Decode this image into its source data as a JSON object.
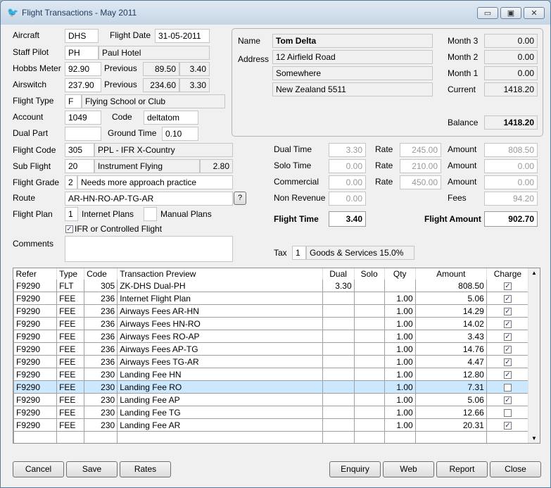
{
  "window": {
    "title": "Flight Transactions - May 2011",
    "min": "▭",
    "max": "▣",
    "close": "✕"
  },
  "form": {
    "aircraft_label": "Aircraft",
    "aircraft": "DHS",
    "flight_date_label": "Flight Date",
    "flight_date": "31-05-2011",
    "staff_pilot_label": "Staff Pilot",
    "staff_pilot_code": "PH",
    "staff_pilot_name": "Paul Hotel",
    "hobbs_label": "Hobbs Meter",
    "hobbs": "92.90",
    "previous_label": "Previous",
    "hobbs_prev": "89.50",
    "hobbs_diff": "3.40",
    "airswitch_label": "Airswitch",
    "airswitch": "237.90",
    "airswitch_prev": "234.60",
    "airswitch_diff": "3.30",
    "flight_type_label": "Flight Type",
    "flight_type_code": "F",
    "flight_type_name": "Flying School or Club",
    "account_label": "Account",
    "account": "1049",
    "code_label": "Code",
    "code": "deltatom",
    "dual_part_label": "Dual Part",
    "dual_part": "",
    "ground_time_label": "Ground Time",
    "ground_time": "0.10",
    "flight_code_label": "Flight Code",
    "flight_code": "305",
    "flight_code_name": "PPL - IFR X-Country",
    "sub_flight_label": "Sub Flight",
    "sub_flight": "20",
    "sub_flight_name": "Instrument Flying",
    "sub_flight_value": "2.80",
    "flight_grade_label": "Flight Grade",
    "flight_grade": "2",
    "flight_grade_name": "Needs more approach practice",
    "route_label": "Route",
    "route": "AR-HN-RO-AP-TG-AR",
    "route_help": "?",
    "flight_plan_label": "Flight Plan",
    "flight_plan_value": "1",
    "internet_plans_label": "Internet Plans",
    "manual_plans_value": "",
    "manual_plans_label": "Manual Plans",
    "ifr_label": "IFR or Controlled Flight",
    "ifr_checked": "✓",
    "comments_label": "Comments",
    "comments": ""
  },
  "customer": {
    "name_label": "Name",
    "name": "Tom Delta",
    "address_label": "Address",
    "address1": "12 Airfield Road",
    "address2": "Somewhere",
    "address3": "New Zealand 5511",
    "month3_label": "Month 3",
    "month3": "0.00",
    "month2_label": "Month 2",
    "month2": "0.00",
    "month1_label": "Month 1",
    "month1": "0.00",
    "current_label": "Current",
    "current": "1418.20",
    "balance_label": "Balance",
    "balance": "1418.20"
  },
  "summary": {
    "dual_time_label": "Dual Time",
    "dual_time": "3.30",
    "dual_rate": "245.00",
    "dual_amount": "808.50",
    "solo_time_label": "Solo Time",
    "solo_time": "0.00",
    "solo_rate": "210.00",
    "solo_amount": "0.00",
    "commercial_label": "Commercial",
    "commercial": "0.00",
    "commercial_rate": "450.00",
    "commercial_amount": "0.00",
    "non_revenue_label": "Non Revenue",
    "non_revenue": "0.00",
    "rate_label": "Rate",
    "amount_label": "Amount",
    "fees_label": "Fees",
    "fees": "94.20",
    "flight_time_label": "Flight Time",
    "flight_time": "3.40",
    "flight_amount_label": "Flight Amount",
    "flight_amount": "902.70",
    "tax_label": "Tax",
    "tax_code": "1",
    "tax_name": "Goods & Services 15.0%"
  },
  "grid": {
    "columns": [
      "Refer",
      "Type",
      "Code",
      "Transaction Preview",
      "Dual",
      "Solo",
      "Qty",
      "Amount",
      "Charge"
    ],
    "rows": [
      {
        "refer": "F9290",
        "type": "FLT",
        "code": "305",
        "preview": "ZK-DHS Dual-PH",
        "dual": "3.30",
        "solo": "",
        "qty": "",
        "amount": "808.50",
        "charge": "✓"
      },
      {
        "refer": "F9290",
        "type": "FEE",
        "code": "236",
        "preview": "Internet Flight Plan",
        "dual": "",
        "solo": "",
        "qty": "1.00",
        "amount": "5.06",
        "charge": "✓"
      },
      {
        "refer": "F9290",
        "type": "FEE",
        "code": "236",
        "preview": "Airways Fees AR-HN",
        "dual": "",
        "solo": "",
        "qty": "1.00",
        "amount": "14.29",
        "charge": "✓"
      },
      {
        "refer": "F9290",
        "type": "FEE",
        "code": "236",
        "preview": "Airways Fees HN-RO",
        "dual": "",
        "solo": "",
        "qty": "1.00",
        "amount": "14.02",
        "charge": "✓"
      },
      {
        "refer": "F9290",
        "type": "FEE",
        "code": "236",
        "preview": "Airways Fees RO-AP",
        "dual": "",
        "solo": "",
        "qty": "1.00",
        "amount": "3.43",
        "charge": "✓"
      },
      {
        "refer": "F9290",
        "type": "FEE",
        "code": "236",
        "preview": "Airways Fees AP-TG",
        "dual": "",
        "solo": "",
        "qty": "1.00",
        "amount": "14.76",
        "charge": "✓"
      },
      {
        "refer": "F9290",
        "type": "FEE",
        "code": "236",
        "preview": "Airways Fees TG-AR",
        "dual": "",
        "solo": "",
        "qty": "1.00",
        "amount": "4.47",
        "charge": "✓"
      },
      {
        "refer": "F9290",
        "type": "FEE",
        "code": "230",
        "preview": "Landing Fee HN",
        "dual": "",
        "solo": "",
        "qty": "1.00",
        "amount": "12.80",
        "charge": "✓"
      },
      {
        "refer": "F9290",
        "type": "FEE",
        "code": "230",
        "preview": "Landing Fee RO",
        "dual": "",
        "solo": "",
        "qty": "1.00",
        "amount": "7.31",
        "charge": ""
      },
      {
        "refer": "F9290",
        "type": "FEE",
        "code": "230",
        "preview": "Landing Fee AP",
        "dual": "",
        "solo": "",
        "qty": "1.00",
        "amount": "5.06",
        "charge": "✓"
      },
      {
        "refer": "F9290",
        "type": "FEE",
        "code": "230",
        "preview": "Landing Fee TG",
        "dual": "",
        "solo": "",
        "qty": "1.00",
        "amount": "12.66",
        "charge": ""
      },
      {
        "refer": "F9290",
        "type": "FEE",
        "code": "230",
        "preview": "Landing Fee AR",
        "dual": "",
        "solo": "",
        "qty": "1.00",
        "amount": "20.31",
        "charge": "✓"
      },
      {
        "refer": "",
        "type": "",
        "code": "",
        "preview": "",
        "dual": "",
        "solo": "",
        "qty": "",
        "amount": "",
        "charge": ""
      }
    ],
    "selected_row": 8
  },
  "buttons": {
    "cancel": "Cancel",
    "save": "Save",
    "rates": "Rates",
    "enquiry": "Enquiry",
    "web": "Web",
    "report": "Report",
    "close": "Close"
  },
  "colors": {
    "selected_row": "#cce8ff",
    "title_text": "#1e395b"
  }
}
